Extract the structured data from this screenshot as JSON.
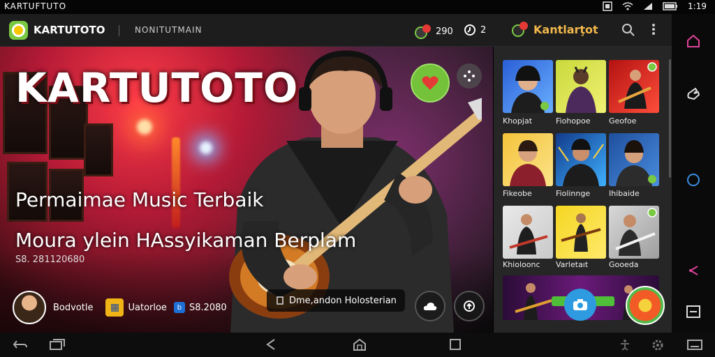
{
  "status": {
    "app_name": "KARTUFTUTO",
    "time": "1:19"
  },
  "appbar": {
    "title": "KARTUTOTO",
    "subtitle": "NONITUTMAIN",
    "counter1": "290",
    "counter2": "2",
    "brand": "Kantlarţot"
  },
  "hero": {
    "title": "KARTUTOTO",
    "line1": "Permaimae Music Terbaik",
    "line2": "Moura ylein HAssyikaman Berplam",
    "code": "S8. 281120680",
    "profile_name": "Bodvotle",
    "tag1": "Uatorloe",
    "tag2": "S8.2080",
    "toast": "Dme,andon Holosterian"
  },
  "panel": {
    "tiles": [
      {
        "label": "Khopjat"
      },
      {
        "label": "Fiohopoe"
      },
      {
        "label": "Geofoe"
      },
      {
        "label": "Fikeobe"
      },
      {
        "label": "Fiolinnge"
      },
      {
        "label": "Ihibaide"
      },
      {
        "label": "Khioloonc"
      },
      {
        "label": "Varletaıt"
      },
      {
        "label": "Gooeda"
      }
    ]
  },
  "colors": {
    "accent": "#7ac943",
    "brand": "#f2b84b",
    "fab": "#2e9be0",
    "nav_pink": "#e0429a",
    "nav_blue": "#3b8de0"
  }
}
